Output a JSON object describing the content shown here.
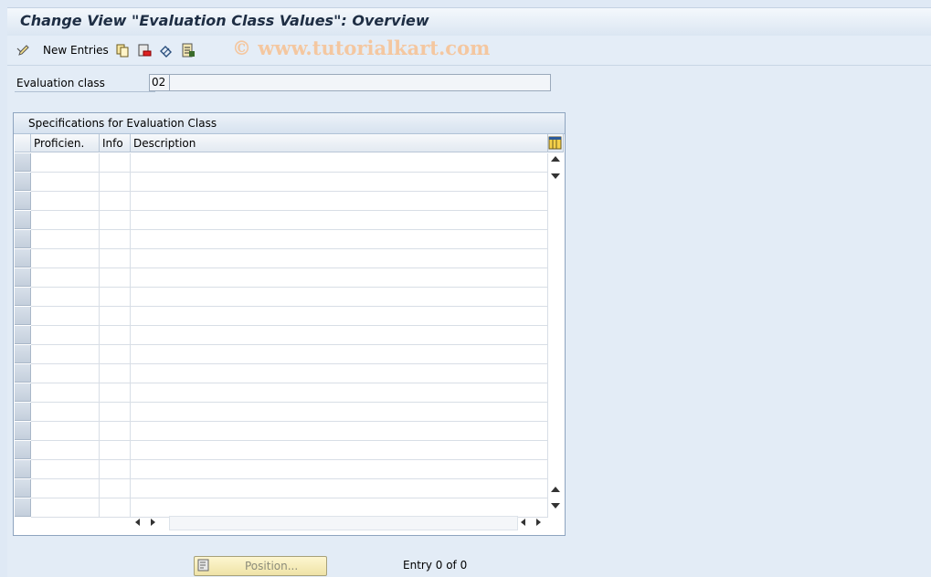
{
  "window": {
    "title": "Change View \"Evaluation Class Values\": Overview"
  },
  "toolbar": {
    "new_entries_label": "New Entries",
    "icons": [
      "edit-pencil-icon",
      "copy-icon",
      "delete-icon",
      "undo-icon",
      "select-all-icon"
    ]
  },
  "watermark": "© www.tutorialkart.com",
  "header": {
    "evaluation_class_label": "Evaluation class",
    "evaluation_class_value": "02",
    "evaluation_class_description": ""
  },
  "table": {
    "group_title": "Specifications for Evaluation Class",
    "columns": [
      "Proficien.",
      "Info",
      "Description"
    ],
    "rows": []
  },
  "footer": {
    "position_button_label": "Position...",
    "entry_status": "Entry 0 of 0"
  },
  "colors": {
    "background": "#dfe9f5",
    "title_text": "#1e2e44",
    "button_bg": "#fdf6d0"
  }
}
